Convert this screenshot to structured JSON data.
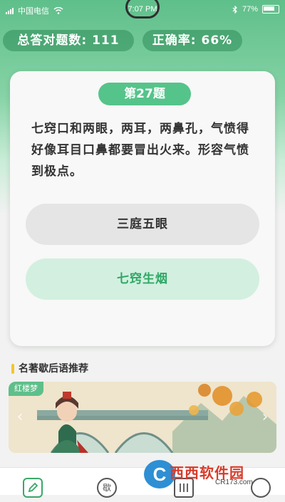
{
  "colors": {
    "brand_green": "#5fbf8a",
    "badge_green": "#55c48a",
    "correct_text": "#2fa866",
    "correct_bg": "#d3efe0",
    "neutral_option_bg": "#e4e5e4",
    "section_accent": "#f3c52c"
  },
  "status_bar": {
    "carrier": "中国电信",
    "time": "7:07 PM",
    "battery": "77%",
    "icons": [
      "signal-icon",
      "wifi-icon",
      "bluetooth-icon",
      "battery-icon"
    ]
  },
  "stats": {
    "total_label": "总答对题数: 111",
    "rate_label": "正确率: 66%"
  },
  "question": {
    "badge": "第27题",
    "text": "七窍口和两眼，两耳，两鼻孔，气愤得好像耳目口鼻都要冒出火来。形容气愤到极点。",
    "options": [
      {
        "label": "三庭五眼",
        "state": "neutral"
      },
      {
        "label": "七窍生烟",
        "state": "correct"
      }
    ]
  },
  "section": {
    "title": "名著歇后语推荐"
  },
  "banner": {
    "tag": "红楼梦",
    "prev_icon": "chevron-left-icon",
    "next_icon": "chevron-right-icon"
  },
  "tabbar": {
    "icons": [
      "edit-icon",
      "song-icon",
      "book-icon",
      "profile-icon"
    ],
    "tab2_label": "歇"
  },
  "watermark": {
    "logo_letter": "C",
    "text": "西西软件园",
    "url": "CR173.com"
  }
}
